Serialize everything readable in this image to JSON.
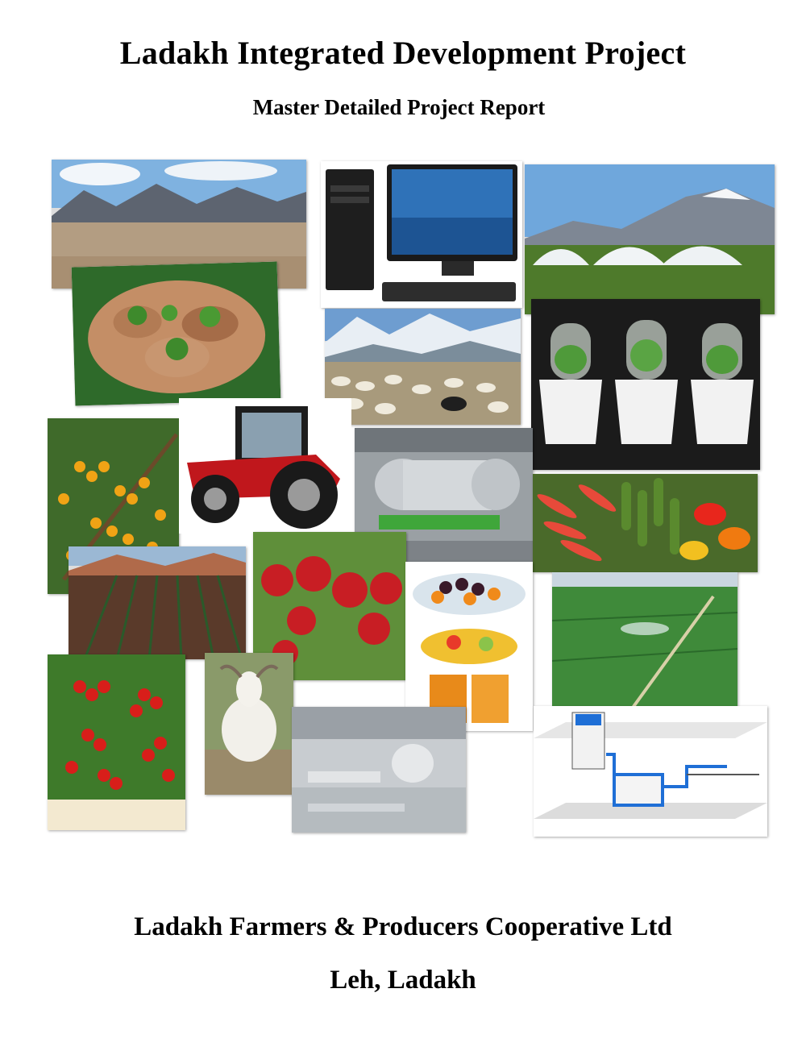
{
  "cover": {
    "title": "Ladakh Integrated Development Project",
    "subtitle": "Master Detailed Project Report",
    "organization": "Ladakh Farmers & Producers Cooperative Ltd",
    "location": "Leh, Ladakh"
  },
  "collage": [
    {
      "subject": "mountain-landscape"
    },
    {
      "subject": "desktop-computer"
    },
    {
      "subject": "greenhouses"
    },
    {
      "subject": "hands-holding-seedlings"
    },
    {
      "subject": "sheep-herd"
    },
    {
      "subject": "potted-plants-under-domes"
    },
    {
      "subject": "sea-buckthorn-berries"
    },
    {
      "subject": "red-tractor"
    },
    {
      "subject": "processing-machinery"
    },
    {
      "subject": "vegetables"
    },
    {
      "subject": "crop-rows-field"
    },
    {
      "subject": "apples-on-tree"
    },
    {
      "subject": "dried-fruits"
    },
    {
      "subject": "irrigated-green-field"
    },
    {
      "subject": "cherry-tomatoes"
    },
    {
      "subject": "white-goat"
    },
    {
      "subject": "processing-facility"
    },
    {
      "subject": "drip-irrigation-diagram"
    }
  ]
}
